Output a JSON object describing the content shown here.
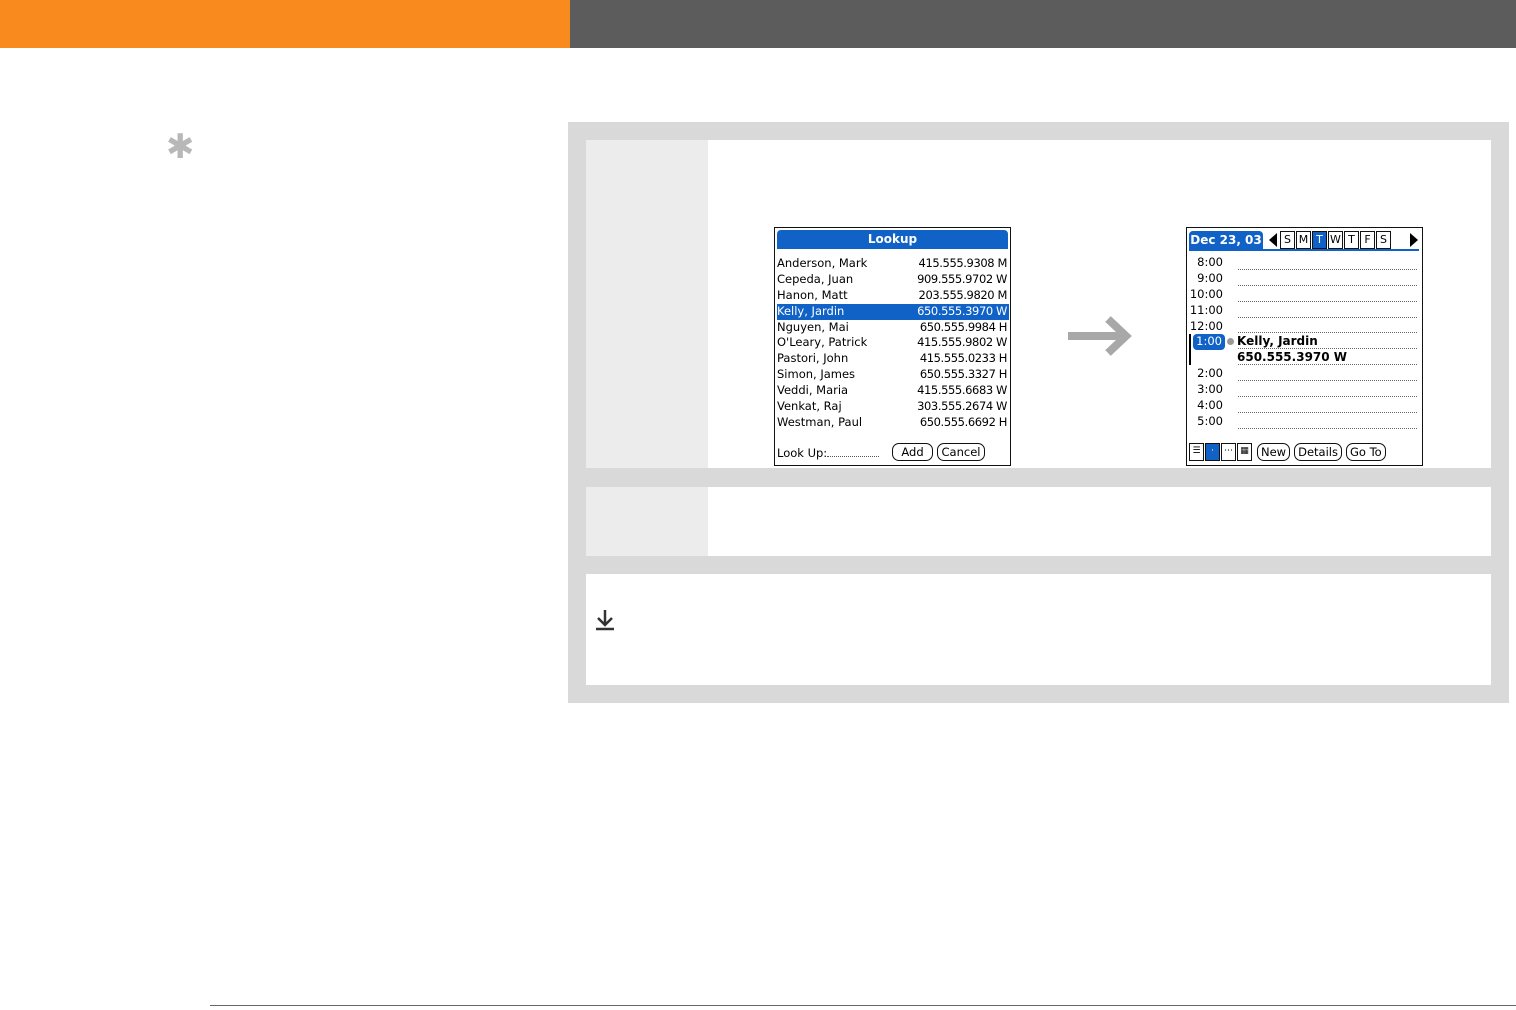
{
  "tip": {
    "icon": "asterisk-icon"
  },
  "lookup_screen": {
    "title": "Lookup",
    "rows": [
      {
        "name": "Anderson, Mark",
        "phone": "415.555.9308 M",
        "selected": false
      },
      {
        "name": "Cepeda, Juan",
        "phone": "909.555.9702 W",
        "selected": false
      },
      {
        "name": "Hanon, Matt",
        "phone": "203.555.9820 M",
        "selected": false
      },
      {
        "name": "Kelly, Jardin",
        "phone": "650.555.3970 W",
        "selected": true
      },
      {
        "name": "Nguyen, Mai",
        "phone": "650.555.9984 H",
        "selected": false
      },
      {
        "name": "O'Leary, Patrick",
        "phone": "415.555.9802 W",
        "selected": false
      },
      {
        "name": "Pastori, John",
        "phone": "415.555.0233 H",
        "selected": false
      },
      {
        "name": "Simon, James",
        "phone": "650.555.3327 H",
        "selected": false
      },
      {
        "name": "Veddi, Maria",
        "phone": "415.555.6683 W",
        "selected": false
      },
      {
        "name": "Venkat, Raj",
        "phone": "303.555.2674 W",
        "selected": false
      },
      {
        "name": "Westman, Paul",
        "phone": "650.555.6692 H",
        "selected": false
      }
    ],
    "lookup_label": "Look Up:",
    "add_label": "Add",
    "cancel_label": "Cancel"
  },
  "calendar_screen": {
    "date": "Dec 23, 03",
    "week_days": [
      "S",
      "M",
      "T",
      "W",
      "T",
      "F",
      "S"
    ],
    "selected_day_index": 2,
    "times": [
      "8:00",
      "9:00",
      "10:00",
      "11:00",
      "12:00",
      "1:00",
      "",
      "2:00",
      "3:00",
      "4:00",
      "5:00"
    ],
    "selected_time_index": 5,
    "event_name": "Kelly, Jardin",
    "event_phone": "650.555.3970 W",
    "new_label": "New",
    "details_label": "Details",
    "goto_label": "Go To"
  },
  "colors": {
    "accent": "#f98b1e",
    "header_gray": "#5c5c5c",
    "palm_blue": "#1062c6"
  }
}
